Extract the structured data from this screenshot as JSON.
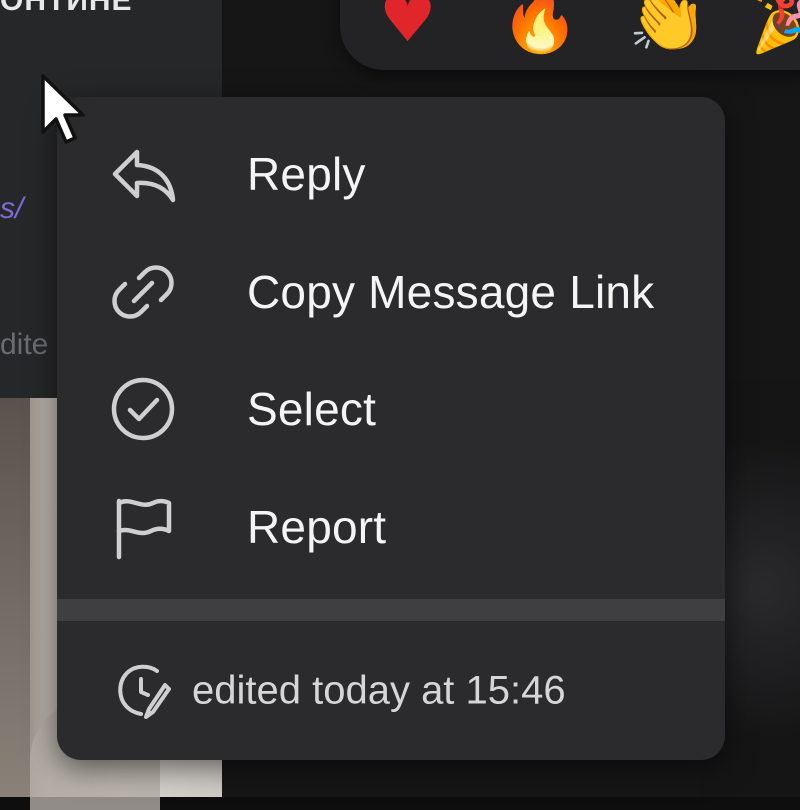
{
  "background": {
    "top_text_fragment": "ОНТИНЕ",
    "link_fragment": "s/",
    "edited_fragment": "dite"
  },
  "reactions": [
    {
      "name": "heart",
      "glyph": "♥"
    },
    {
      "name": "fire",
      "glyph": "🔥"
    },
    {
      "name": "clap",
      "glyph": "👏"
    },
    {
      "name": "party",
      "glyph": "🎉"
    }
  ],
  "context_menu": {
    "items": [
      {
        "label": "Reply",
        "icon": "reply-icon"
      },
      {
        "label": "Copy Message Link",
        "icon": "link-icon"
      },
      {
        "label": "Select",
        "icon": "check-circle-icon"
      },
      {
        "label": "Report",
        "icon": "flag-icon"
      }
    ],
    "edited_info": "edited today at 15:46",
    "edited_icon": "edit-clock-icon"
  },
  "colors": {
    "menu_bg": "#2b2b2d",
    "separator": "#3f3f42",
    "text": "#f4f4f4",
    "icon": "#cfcfd1",
    "link": "#7f6ad6"
  }
}
